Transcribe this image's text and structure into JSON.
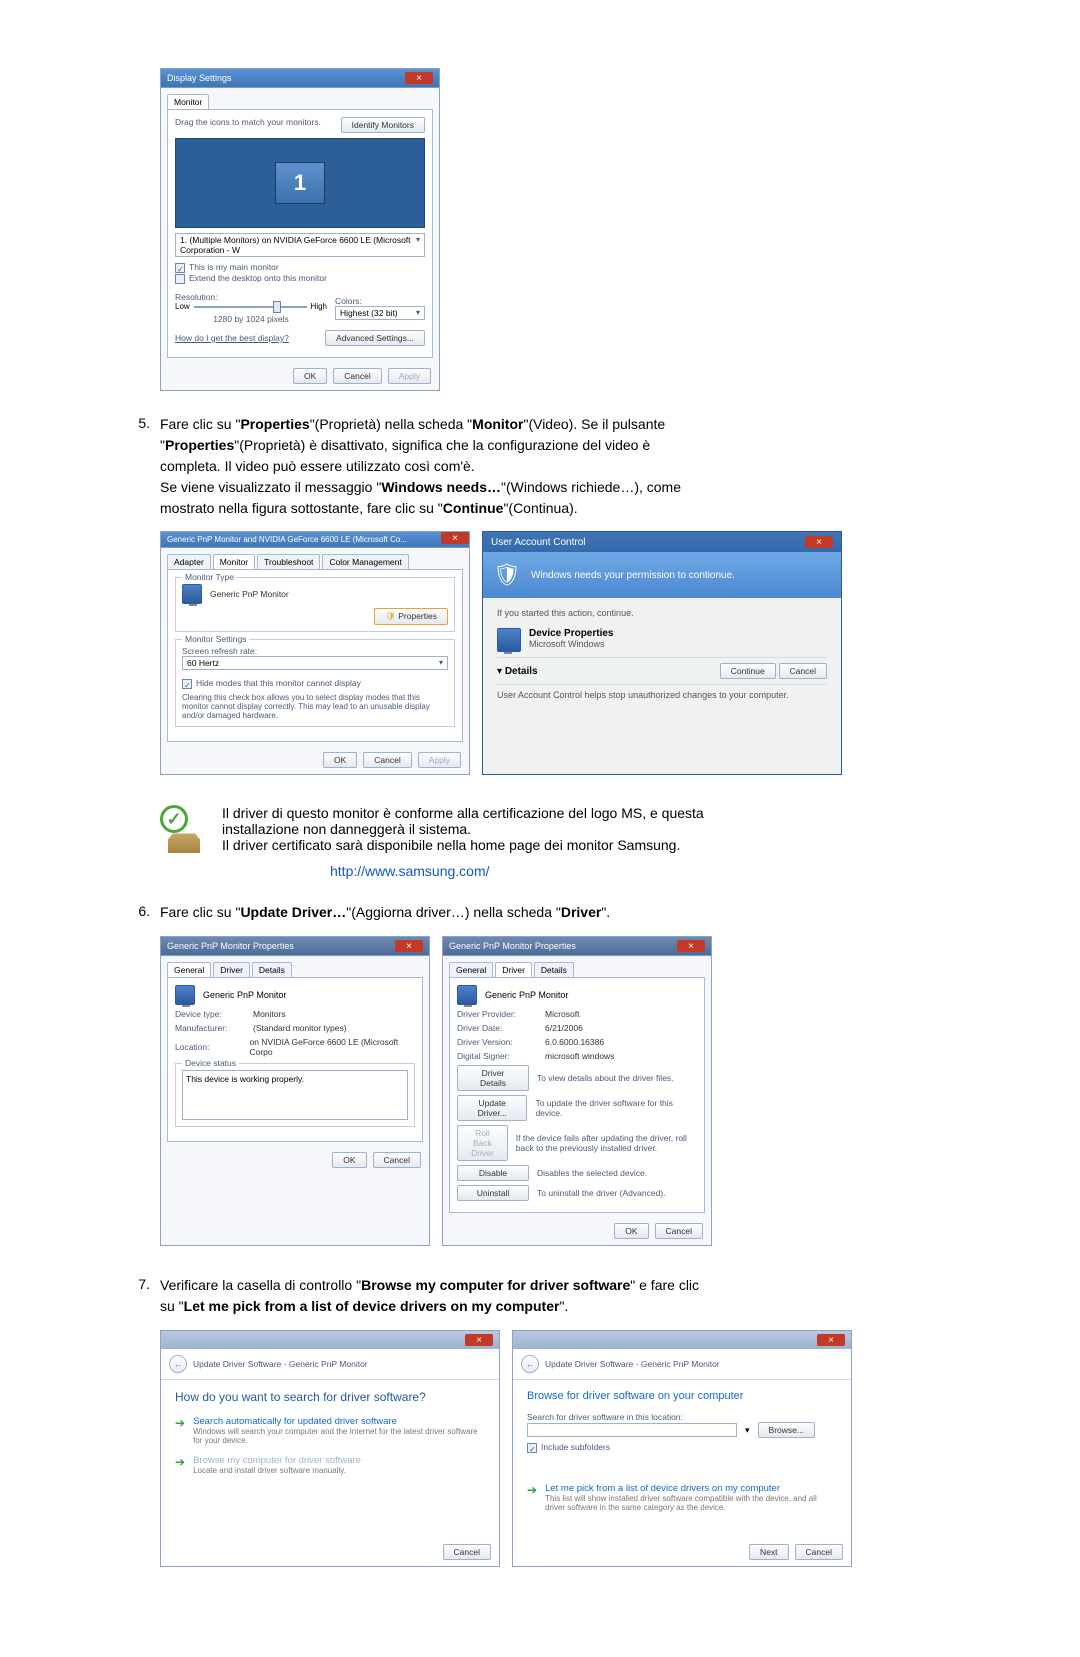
{
  "displaySettings": {
    "title": "Display Settings",
    "tab": "Monitor",
    "dragText": "Drag the icons to match your monitors.",
    "identifyBtn": "Identify Monitors",
    "monitorNum": "1",
    "dropdown": "1. (Multiple Monitors) on NVIDIA GeForce 6600 LE (Microsoft Corporation - W",
    "chkMain": "This is my main monitor",
    "chkExtend": "Extend the desktop onto this monitor",
    "resLabel": "Resolution:",
    "resLow": "Low",
    "resHigh": "High",
    "resValue": "1280 by 1024 pixels",
    "colorsLabel": "Colors:",
    "colorsValue": "Highest (32 bit)",
    "helplink": "How do I get the best display?",
    "advBtn": "Advanced Settings...",
    "ok": "OK",
    "cancel": "Cancel",
    "apply": "Apply"
  },
  "step5": {
    "num": "5.",
    "line1a": "Fare clic su \"",
    "line1b": "Properties",
    "line1c": "\"(Proprietà) nella scheda \"",
    "line1d": "Monitor",
    "line1e": "\"(Video). Se il pulsante",
    "line2a": "\"",
    "line2b": "Properties",
    "line2c": "\"(Proprietà) è disattivato, significa che la configurazione del video è",
    "line3": "completa. Il video può essere utilizzato così com'è.",
    "line4a": "Se viene visualizzato il messaggio \"",
    "line4b": "Windows needs…",
    "line4c": "\"(Windows richiede…), come",
    "line5a": "mostrato nella figura sottostante, fare clic su \"",
    "line5b": "Continue",
    "line5c": "\"(Continua)."
  },
  "monProps": {
    "title": "Generic PnP Monitor and NVIDIA GeForce 6600 LE (Microsoft Co...",
    "tabAdapter": "Adapter",
    "tabMonitor": "Monitor",
    "tabTroubleshoot": "Troubleshoot",
    "tabColor": "Color Management",
    "fsType": "Monitor Type",
    "typeVal": "Generic PnP Monitor",
    "propsBtn": "Properties",
    "fsSettings": "Monitor Settings",
    "refreshLbl": "Screen refresh rate:",
    "refreshVal": "60 Hertz",
    "hideChk": "Hide modes that this monitor cannot display",
    "hideNote": "Clearing this check box allows you to select display modes that this monitor cannot display correctly. This may lead to an unusable display and/or damaged hardware.",
    "ok": "OK",
    "cancel": "Cancel",
    "apply": "Apply"
  },
  "uac": {
    "title": "User Account Control",
    "banner": "Windows needs your permission to contionue.",
    "ifyou": "If you started this action, continue.",
    "devProps": "Device Properties",
    "msw": "Microsoft Windows",
    "details": "Details",
    "cont": "Continue",
    "cancel": "Cancel",
    "foot": "User Account Control helps stop unauthorized changes to your computer."
  },
  "infoNote": {
    "line1": "Il driver di questo monitor è conforme alla certificazione del logo MS, e questa",
    "line2": "installazione non danneggerà il sistema.",
    "line3": "Il driver certificato sarà disponibile nella home page dei monitor Samsung.",
    "link": "http://www.samsung.com/"
  },
  "step6": {
    "num": "6.",
    "text1": "Fare clic su \"",
    "text2": "Update Driver…",
    "text3": "\"(Aggiorna driver…) nella scheda \"",
    "text4": "Driver",
    "text5": "\"."
  },
  "genProps": {
    "title": "Generic PnP Monitor Properties",
    "tabGeneral": "General",
    "tabDriver": "Driver",
    "tabDetails": "Details",
    "name": "Generic PnP Monitor",
    "devTypeLbl": "Device type:",
    "devTypeVal": "Monitors",
    "mfgLbl": "Manufacturer:",
    "mfgVal": "(Standard monitor types)",
    "locLbl": "Location:",
    "locVal": "on NVIDIA GeForce 6600 LE (Microsoft Corpo",
    "devStatusLbl": "Device status",
    "devStatus": "This device is working properly.",
    "ok": "OK",
    "cancel": "Cancel"
  },
  "drvTab": {
    "title": "Generic PnP Monitor Properties",
    "name": "Generic PnP Monitor",
    "provLbl": "Driver Provider:",
    "provVal": "Microsoft",
    "dateLbl": "Driver Date:",
    "dateVal": "6/21/2006",
    "verLbl": "Driver Version:",
    "verVal": "6.0.6000.16386",
    "sigLbl": "Digital Signer:",
    "sigVal": "microsoft windows",
    "btnDetails": "Driver Details",
    "txtDetails": "To view details about the driver files.",
    "btnUpdate": "Update Driver...",
    "txtUpdate": "To update the driver software for this device.",
    "btnRollback": "Roll Back Driver",
    "txtRollback": "If the device fails after updating the driver, roll back to the previously installed driver.",
    "btnDisable": "Disable",
    "txtDisable": "Disables the selected device.",
    "btnUninstall": "Uninstall",
    "txtUninstall": "To uninstall the driver (Advanced).",
    "ok": "OK",
    "cancel": "Cancel"
  },
  "step7": {
    "num": "7.",
    "line1a": "Verificare la casella di controllo \"",
    "line1b": "Browse my computer for driver software",
    "line1c": "\" e fare clic",
    "line2a": "su \"",
    "line2b": "Let me pick from a list of device drivers on my computer",
    "line2c": "\"."
  },
  "wiz1": {
    "title": "Update Driver Software - Generic PnP Monitor",
    "heading": "How do you want to search for driver software?",
    "opt1t": "Search automatically for updated driver software",
    "opt1s": "Windows will search your computer and the Internet for the latest driver software for your device.",
    "opt2t": "Browse my computer for driver software",
    "opt2s": "Locate and install driver software manually.",
    "cancel": "Cancel"
  },
  "wiz2": {
    "title": "Update Driver Software - Generic PnP Monitor",
    "heading": "Browse for driver software on your computer",
    "searchLbl": "Search for driver software in this location:",
    "browse": "Browse...",
    "include": "Include subfolders",
    "optT": "Let me pick from a list of device drivers on my computer",
    "optS": "This list will show installed driver software compatible with the device, and all driver software in the same category as the device.",
    "next": "Next",
    "cancel": "Cancel"
  }
}
